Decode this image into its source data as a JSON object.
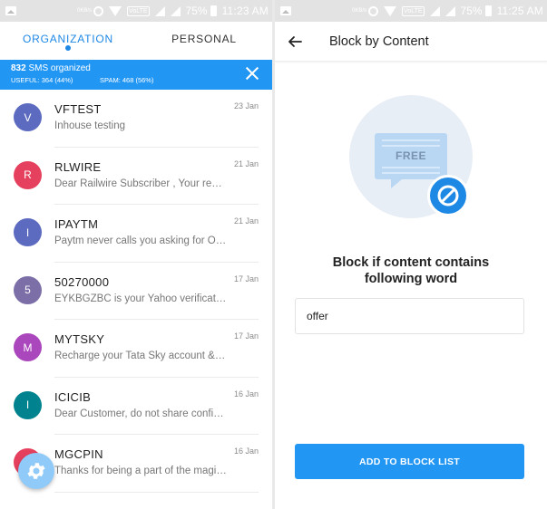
{
  "status_left": {
    "percent": "75%",
    "time": "11:23 AM",
    "kb_rate": "0KB/s"
  },
  "status_right": {
    "percent": "75%",
    "time": "11:25 AM",
    "kb_rate": "0KB/s"
  },
  "inbox": {
    "tabs": [
      {
        "label": "ORGANIZATION",
        "active": true
      },
      {
        "label": "PERSONAL",
        "active": false
      }
    ],
    "banner": {
      "count": "832",
      "text": "SMS organized",
      "useful": "USEFUL: 364 (44%)",
      "spam": "SPAM: 468 (56%)"
    },
    "messages": [
      {
        "avatar": "V",
        "color": "#5c6bc0",
        "sender": "VFTEST",
        "date": "23 Jan",
        "preview": "Inhouse testing"
      },
      {
        "avatar": "R",
        "color": "#e5405e",
        "sender": "RLWIRE",
        "date": "21 Jan",
        "preview": "Dear Railwire Subscriber , Your request"
      },
      {
        "avatar": "I",
        "color": "#5c6bc0",
        "sender": "IPAYTM",
        "date": "21 Jan",
        "preview": "Paytm never calls you asking for OTP"
      },
      {
        "avatar": "5",
        "color": "#7c6fa8",
        "sender": "50270000",
        "date": "17 Jan",
        "preview": "EYKBGZBC is your Yahoo verification code"
      },
      {
        "avatar": "M",
        "color": "#ab47bc",
        "sender": "MYTSKY",
        "date": "17 Jan",
        "preview": "Recharge your Tata Sky account & get"
      },
      {
        "avatar": "I",
        "color": "#00838f",
        "sender": "ICICIB",
        "date": "16 Jan",
        "preview": "Dear Customer, do not share confidential"
      },
      {
        "avatar": "",
        "color": "#e5405e",
        "sender": "MGCPIN",
        "date": "16 Jan",
        "preview": "Thanks for being a part of the magicpin"
      }
    ]
  },
  "block_screen": {
    "title": "Block by Content",
    "illustration_label": "FREE",
    "heading_line1": "Block if content contains",
    "heading_line2": "following word",
    "input_value": "offer",
    "button_label": "ADD TO BLOCK LIST"
  },
  "colors": {
    "primary": "#2196f3",
    "accent": "#1e88e5"
  },
  "icons": [
    "image-icon",
    "alarm-icon",
    "wifi-icon",
    "signal-icon",
    "battery-icon",
    "close-icon",
    "gear-icon",
    "back-arrow-icon",
    "block-icon"
  ]
}
